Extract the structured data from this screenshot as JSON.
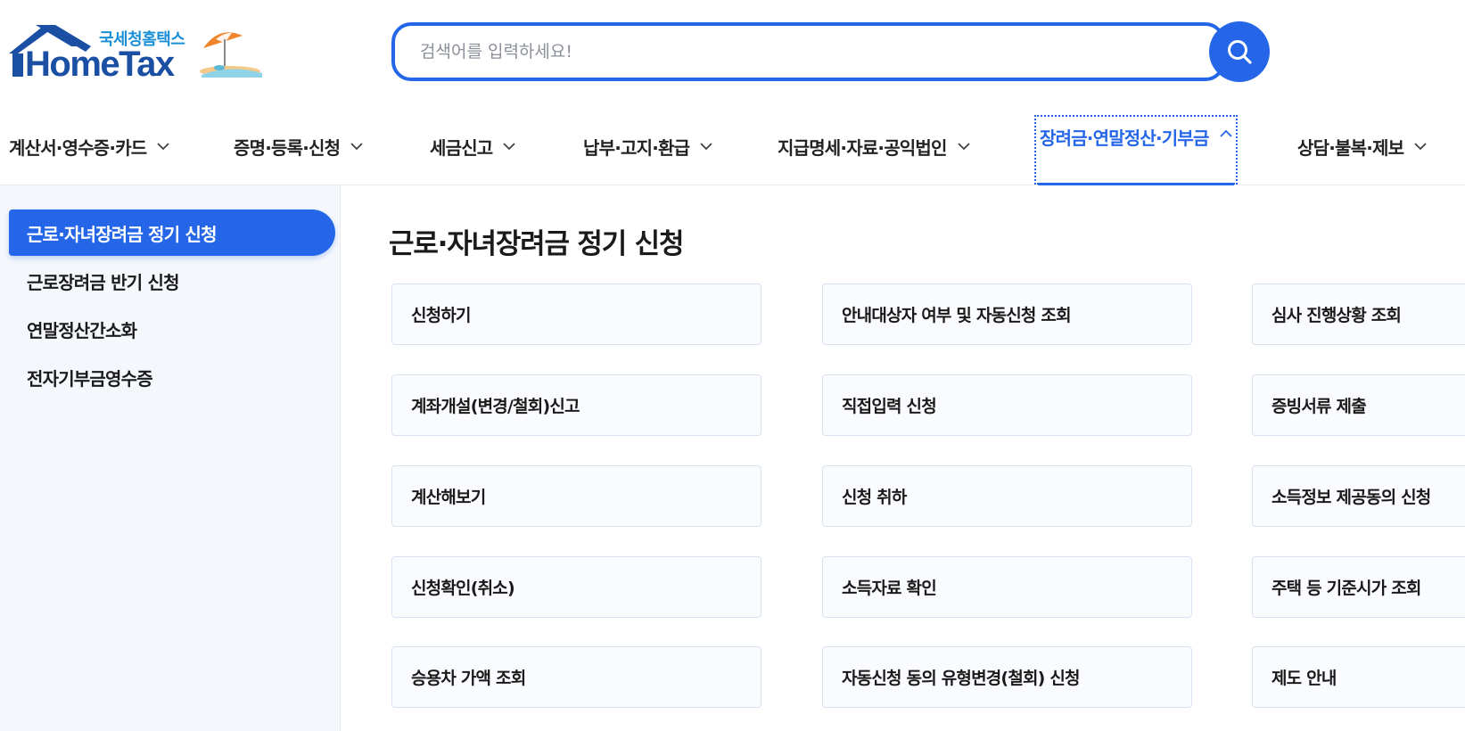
{
  "logo": {
    "sub_text": "국세청홈택스",
    "main_text": "HomeTax"
  },
  "search": {
    "placeholder": "검색어를 입력하세요!",
    "value": ""
  },
  "gnb": {
    "items": [
      {
        "label": "계산서·영수증·카드",
        "expanded": false
      },
      {
        "label": "증명·등록·신청",
        "expanded": false
      },
      {
        "label": "세금신고",
        "expanded": false
      },
      {
        "label": "납부·고지·환급",
        "expanded": false
      },
      {
        "label": "지급명세·자료·공익법인",
        "expanded": false
      },
      {
        "label": "장려금·연말정산·기부금",
        "expanded": true
      },
      {
        "label": "상담·불복·제보",
        "expanded": false
      }
    ]
  },
  "sidebar": {
    "items": [
      {
        "label": "근로·자녀장려금 정기 신청",
        "active": true
      },
      {
        "label": "근로장려금 반기 신청",
        "active": false
      },
      {
        "label": "연말정산간소화",
        "active": false
      },
      {
        "label": "전자기부금영수증",
        "active": false
      }
    ]
  },
  "main": {
    "title": "근로·자녀장려금 정기 신청",
    "cards": [
      [
        "신청하기",
        "안내대상자 여부 및 자동신청 조회",
        "심사 진행상황 조회"
      ],
      [
        "계좌개설(변경/철회)신고",
        "직접입력 신청",
        "증빙서류 제출"
      ],
      [
        "계산해보기",
        "신청 취하",
        "소득정보 제공동의 신청"
      ],
      [
        "신청확인(취소)",
        "소득자료 확인",
        "주택 등 기준시가 조회"
      ],
      [
        "승용차 가액 조회",
        "자동신청 동의 유형변경(철회) 신청",
        "제도 안내"
      ]
    ]
  },
  "colors": {
    "accent": "#2566e8",
    "logo_blue": "#1a4fa3",
    "logo_sub": "#1b8fd6",
    "sidebar_bg": "#f4f7fc",
    "card_border": "#d9e2f1"
  },
  "icons": {
    "search_button": "search-icon",
    "gnb_collapsed": "chevron-down-icon",
    "gnb_expanded": "chevron-up-icon"
  }
}
